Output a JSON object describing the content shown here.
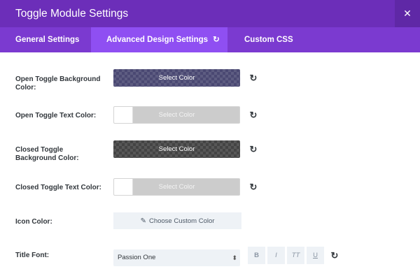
{
  "header": {
    "title": "Toggle Module Settings",
    "close_glyph": "✕"
  },
  "tabs": [
    {
      "label": "General Settings"
    },
    {
      "label": "Advanced Design Settings",
      "reset_glyph": "↻"
    },
    {
      "label": "Custom CSS"
    }
  ],
  "rows": {
    "open_bg": {
      "label_line1": "Open Toggle Background",
      "label_line2": "Color:",
      "button": "Select Color"
    },
    "open_text": {
      "label": "Open Toggle Text Color:",
      "button": "Select Color"
    },
    "closed_bg": {
      "label_line1": "Closed Toggle",
      "label_line2": "Background Color:",
      "button": "Select Color"
    },
    "closed_text": {
      "label": "Closed Toggle Text Color:",
      "button": "Select Color"
    },
    "icon_color": {
      "label": "Icon Color:",
      "button": "Choose Custom Color",
      "icon": "pencil-icon"
    },
    "title_font": {
      "label": "Title Font:",
      "value": "Passion One",
      "styles": [
        "B",
        "I",
        "TT",
        "U"
      ]
    }
  },
  "reset_glyph": "↻",
  "colors": {
    "header": "#6c2eb9",
    "tabs": "#7b3ad0",
    "active_tab": "#8f4ff2",
    "open_bg_swatch": "#4b4973",
    "closed_bg_swatch": "#444444"
  }
}
